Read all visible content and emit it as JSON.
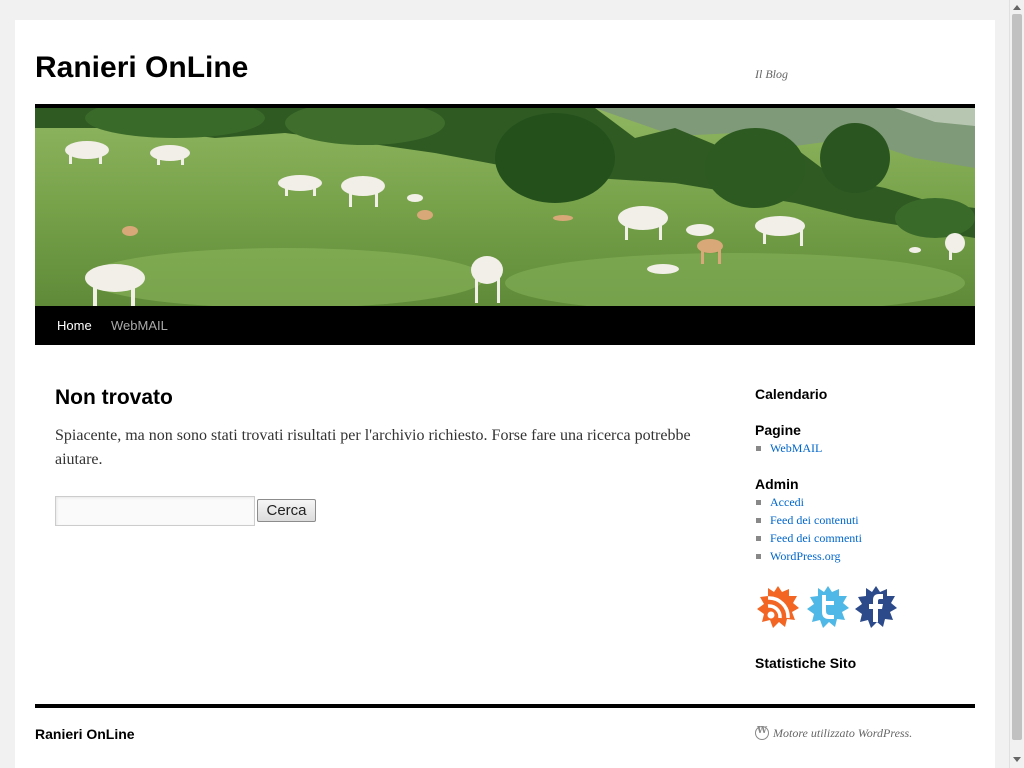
{
  "site": {
    "title": "Ranieri OnLine",
    "description": "Il Blog"
  },
  "banner": {
    "icon": "meadow-cows-banner"
  },
  "menu": {
    "items": [
      {
        "label": "Home",
        "current": true
      },
      {
        "label": "WebMAIL",
        "current": false
      }
    ]
  },
  "content": {
    "title": "Non trovato",
    "text": "Spiacente, ma non sono stati trovati risultati per l'archivio richiesto. Forse fare una ricerca potrebbe aiutare.",
    "search": {
      "value": "",
      "placeholder": "",
      "button_label": "Cerca"
    }
  },
  "sidebar": {
    "calendar_title": "Calendario",
    "pages_title": "Pagine",
    "pages": [
      "WebMAIL"
    ],
    "admin_title": "Admin",
    "admin": [
      "Accedi",
      "Feed dei contenuti",
      "Feed dei commenti",
      "WordPress.org"
    ],
    "social": [
      "rss-icon",
      "twitter-icon",
      "facebook-icon"
    ],
    "stats_title": "Statistiche Sito"
  },
  "footer": {
    "title": "Ranieri OnLine",
    "credit": "Motore utilizzato WordPress."
  },
  "colors": {
    "link": "#0066cc",
    "menu_bg": "#000000",
    "page_bg": "#f1f1f1",
    "rss": "#f26522",
    "twitter": "#4fb8e6",
    "facebook": "#2c4a8a"
  }
}
